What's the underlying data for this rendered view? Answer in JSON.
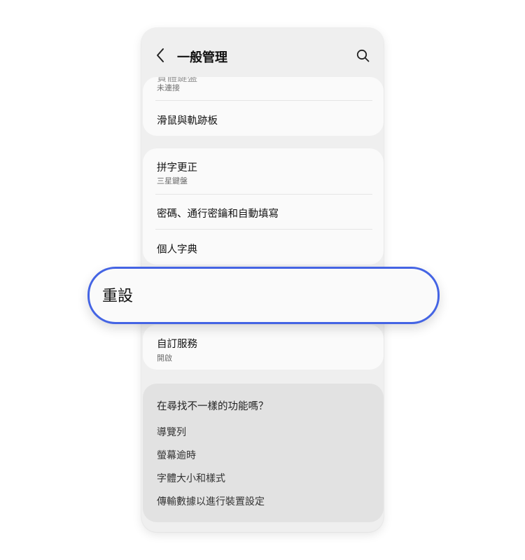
{
  "header": {
    "title": "一般管理"
  },
  "card1": {
    "partial_title": "實體鍵盤",
    "partial_sub": "未連接",
    "mouse_title": "滑鼠與軌跡板"
  },
  "card2": {
    "items": [
      {
        "title": "拼字更正",
        "sub": "三星鍵盤"
      },
      {
        "title": "密碼、通行密鑰和自動填寫"
      },
      {
        "title": "個人字典"
      }
    ]
  },
  "reset_label": "重設",
  "card4": {
    "title": "自訂服務",
    "sub": "開啟"
  },
  "looking": {
    "question": "在尋找不一樣的功能嗎？",
    "links": [
      "導覽列",
      "螢幕逾時",
      "字體大小和樣式",
      "傳輸數據以進行裝置設定"
    ]
  },
  "colors": {
    "accent": "#4464e4",
    "background": "#efefef",
    "card": "#fafafa"
  }
}
